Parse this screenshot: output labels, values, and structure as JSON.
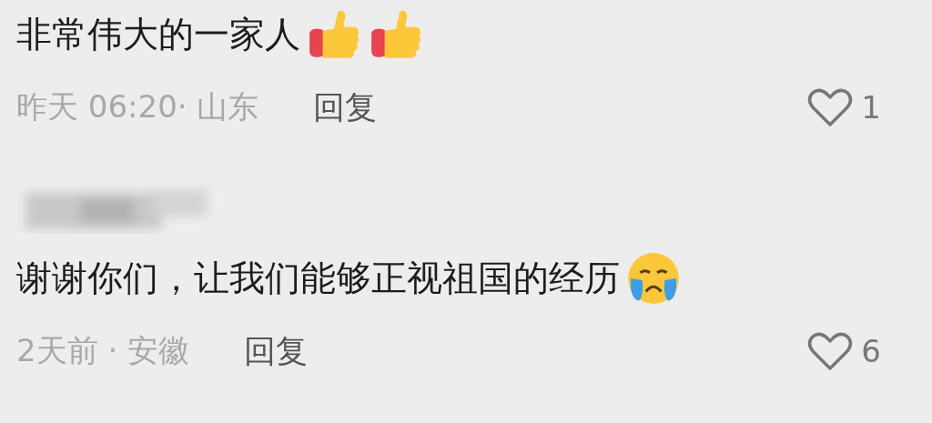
{
  "comments": [
    {
      "author": {
        "kind": "none"
      },
      "text": "非常伟大的一家人",
      "emojis": [
        {
          "kind": "thumbs-up"
        },
        {
          "kind": "thumbs-up"
        }
      ],
      "meta": "昨天 06:20· 山东",
      "reply": "回复",
      "likes": "1"
    },
    {
      "author": {
        "kind": "blurred"
      },
      "text": "谢谢你们，让我们能够正视祖国的经历",
      "emojis": [
        {
          "kind": "crying"
        }
      ],
      "meta": "2天前 · 安徽",
      "reply": "回复",
      "likes": "6"
    }
  ]
}
